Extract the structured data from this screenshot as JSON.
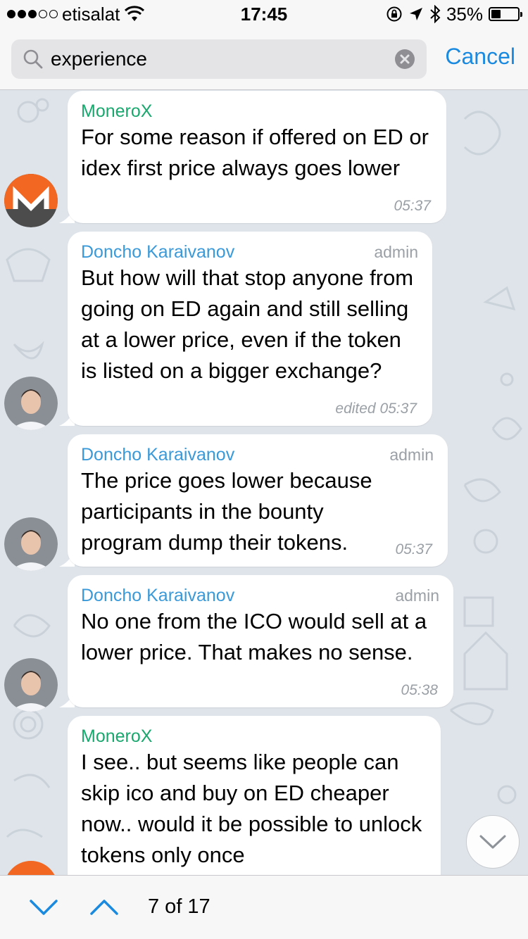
{
  "status_bar": {
    "carrier": "etisalat",
    "time": "17:45",
    "battery": "35%",
    "battery_level": 0.35
  },
  "search": {
    "query": "experience",
    "cancel_label": "Cancel"
  },
  "messages": [
    {
      "sender": "MoneroX",
      "role": "",
      "text": "For some reason if offered on ED or idex first price always goes lower",
      "time": "05:37"
    },
    {
      "sender": "Doncho Karaivanov",
      "role": "admin",
      "text": "But how will that stop anyone from going on ED again and still selling at a lower price, even if the token is listed on a bigger exchange?",
      "time": "edited 05:37"
    },
    {
      "sender": "Doncho Karaivanov",
      "role": "admin",
      "text": "The price goes lower because participants in the bounty program dump their tokens.",
      "time": "05:37"
    },
    {
      "sender": "Doncho Karaivanov",
      "role": "admin",
      "text": "No one from the ICO would sell at a lower price. That makes no sense.",
      "time": "05:38"
    },
    {
      "sender": "MoneroX",
      "role": "",
      "text": "I see.. but seems like people can skip ico and buy on ED cheaper now.. would it be possible to unlock tokens only once",
      "time": ""
    }
  ],
  "bottom": {
    "counter": "7 of 17"
  },
  "colors": {
    "accent": "#1a8ae0",
    "sender_green": "#1aa86f",
    "sender_blue": "#3a9ad9",
    "chat_bg": "#dfe4ea",
    "monero_orange": "#f26822"
  },
  "icons": [
    "search-icon",
    "clear-icon",
    "chevron-down-icon",
    "chevron-up-icon",
    "wifi-icon",
    "lock-rotation-icon",
    "location-icon",
    "bluetooth-icon",
    "battery-icon"
  ]
}
